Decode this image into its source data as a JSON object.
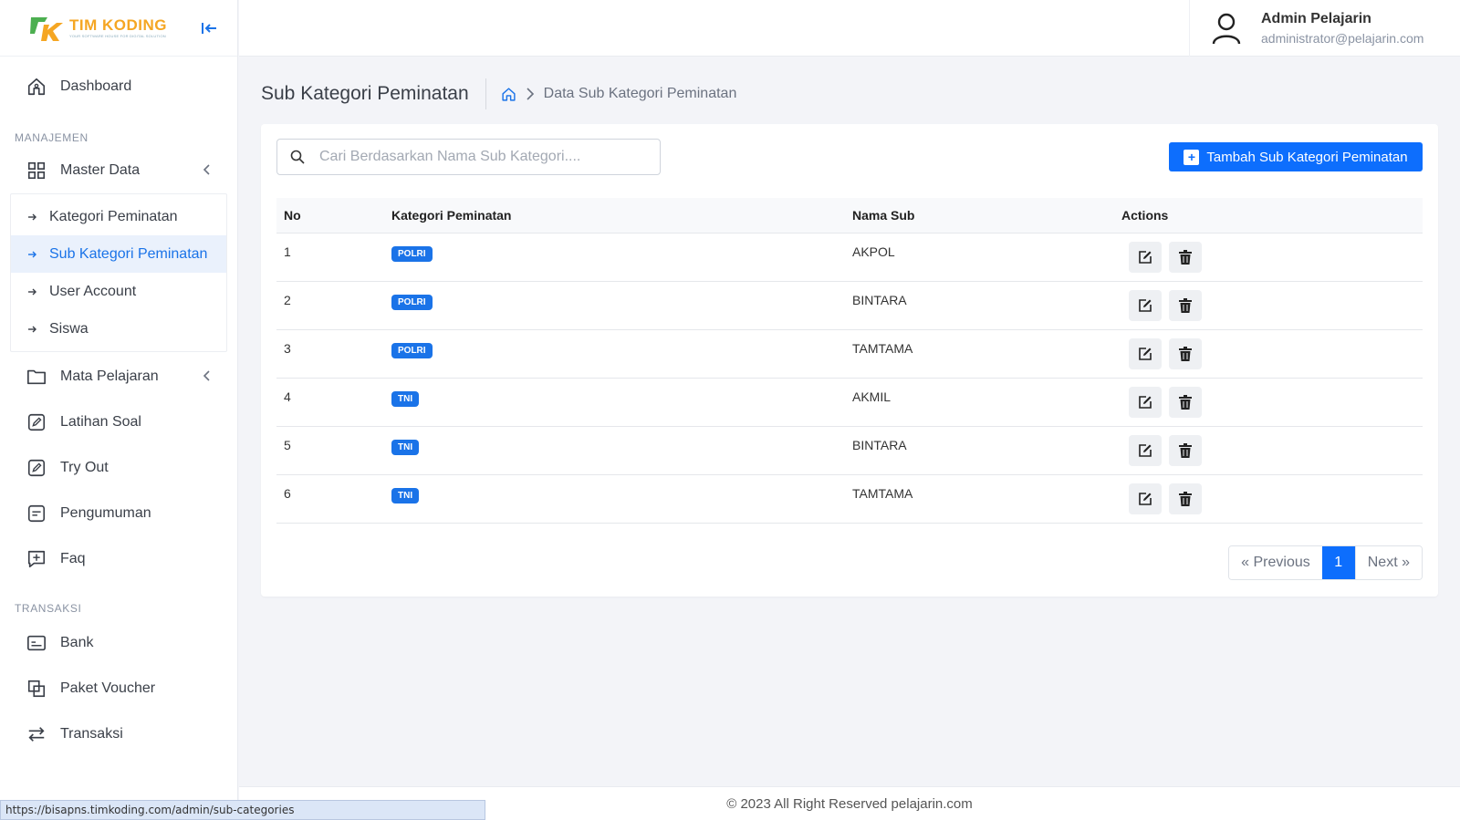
{
  "brand": {
    "name": "TIM KODING",
    "tagline": "YOUR SOFTWARE HOUSE FOR DIGITAL SOLUTION"
  },
  "sidebar": {
    "dashboard": "Dashboard",
    "section_manajemen": "MANAJEMEN",
    "master_data": "Master Data",
    "master_sub": [
      "Kategori Peminatan",
      "Sub Kategori Peminatan",
      "User Account",
      "Siswa"
    ],
    "mata_pelajaran": "Mata Pelajaran",
    "latihan_soal": "Latihan Soal",
    "try_out": "Try Out",
    "pengumuman": "Pengumuman",
    "faq": "Faq",
    "section_transaksi": "TRANSAKSI",
    "bank": "Bank",
    "paket_voucher": "Paket Voucher",
    "transaksi": "Transaksi"
  },
  "user": {
    "name": "Admin Pelajarin",
    "email": "administrator@pelajarin.com"
  },
  "page": {
    "title": "Sub Kategori Peminatan",
    "breadcrumb": "Data Sub Kategori Peminatan"
  },
  "search": {
    "placeholder": "Cari Berdasarkan Nama Sub Kategori...."
  },
  "add_button": "Tambah Sub Kategori Peminatan",
  "table": {
    "headers": [
      "No",
      "Kategori Peminatan",
      "Nama Sub",
      "Actions"
    ],
    "rows": [
      {
        "no": "1",
        "kategori": "POLRI",
        "nama": "AKPOL"
      },
      {
        "no": "2",
        "kategori": "POLRI",
        "nama": "BINTARA"
      },
      {
        "no": "3",
        "kategori": "POLRI",
        "nama": "TAMTAMA"
      },
      {
        "no": "4",
        "kategori": "TNI",
        "nama": "AKMIL"
      },
      {
        "no": "5",
        "kategori": "TNI",
        "nama": "BINTARA"
      },
      {
        "no": "6",
        "kategori": "TNI",
        "nama": "TAMTAMA"
      }
    ]
  },
  "pagination": {
    "previous": "« Previous",
    "current": "1",
    "next": "Next »"
  },
  "footer": "© 2023 All Right Reserved pelajarin.com",
  "status_url": "https://bisapns.timkoding.com/admin/sub-categories",
  "colors": {
    "primary": "#0d6efd",
    "active_bg": "#eaf1fc",
    "logo_orange": "#f5a623",
    "logo_green": "#4caf50"
  }
}
